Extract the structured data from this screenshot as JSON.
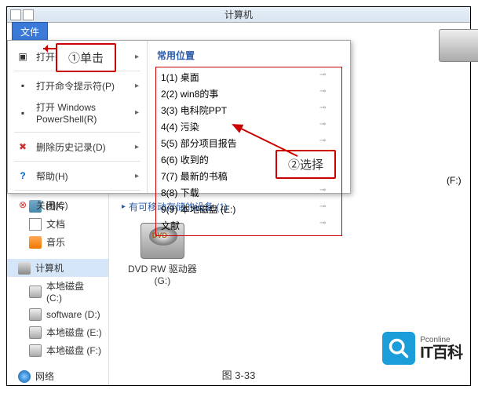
{
  "window": {
    "title": "计算机"
  },
  "file_button": "文件",
  "callouts": {
    "click": "①单击",
    "select": "②选择"
  },
  "file_menu_left": [
    {
      "label": "打开新窗口(N)",
      "icon": "new-window",
      "arrow": true
    },
    {
      "label": "打开命令提示符(P)",
      "icon": "cmd",
      "arrow": true
    },
    {
      "label": "打开 Windows PowerShell(R)",
      "icon": "powershell",
      "arrow": true
    },
    {
      "label": "删除历史记录(D)",
      "icon": "delete-history",
      "arrow": true
    },
    {
      "label": "帮助(H)",
      "icon": "help",
      "arrow": true
    },
    {
      "label": "关闭(C)",
      "icon": "close",
      "arrow": false
    }
  ],
  "freq_header": "常用位置",
  "freq_items": [
    {
      "key": "1(1)",
      "label": "桌面"
    },
    {
      "key": "2(2)",
      "label": "win8的事"
    },
    {
      "key": "3(3)",
      "label": "电科院PPT"
    },
    {
      "key": "4(4)",
      "label": "污染"
    },
    {
      "key": "5(5)",
      "label": "部分项目报告"
    },
    {
      "key": "6(6)",
      "label": "收到的"
    },
    {
      "key": "7(7)",
      "label": "最新的书稿"
    },
    {
      "key": "8(8)",
      "label": "下载"
    },
    {
      "key": "9(9)",
      "label": "本地磁盘 (E:)"
    },
    {
      "key": "",
      "label": "文献"
    }
  ],
  "sidebar": {
    "libs": [
      {
        "label": "图片",
        "icon": "pictures"
      },
      {
        "label": "文档",
        "icon": "documents"
      },
      {
        "label": "音乐",
        "icon": "music"
      }
    ],
    "computer_label": "计算机",
    "drives": [
      {
        "label": "本地磁盘 (C:)"
      },
      {
        "label": "software (D:)"
      },
      {
        "label": "本地磁盘 (E:)"
      },
      {
        "label": "本地磁盘 (F:)"
      }
    ],
    "network_label": "网络"
  },
  "content": {
    "visible_drive_label": "(F:)",
    "removable_header": "有可移动存储的设备 (1)",
    "dvd_label": "DVD RW 驱动器\n(G:)"
  },
  "watermark": {
    "small": "Pconline",
    "big": "IT百科"
  },
  "caption": "图 3-33"
}
